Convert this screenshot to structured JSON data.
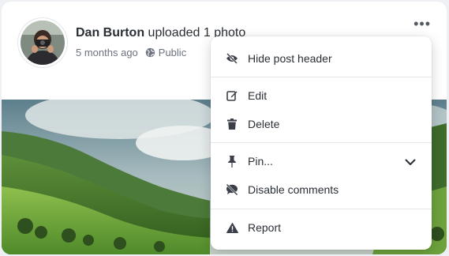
{
  "post": {
    "author": "Dan Burton",
    "action": " uploaded 1 photo",
    "time": "5 months ago",
    "visibility": "Public",
    "more_label": "•••"
  },
  "menu": {
    "items": [
      {
        "label": "Hide post header",
        "icon": "eye-slash-icon"
      },
      {
        "label": "Edit",
        "icon": "edit-icon"
      },
      {
        "label": "Delete",
        "icon": "trash-icon"
      },
      {
        "label": "Pin...",
        "icon": "pin-icon"
      },
      {
        "label": "Disable comments",
        "icon": "comment-slash-icon"
      },
      {
        "label": "Report",
        "icon": "warning-icon"
      }
    ]
  },
  "colors": {
    "text": "#2a2f36",
    "muted": "#6b7280",
    "separator": "#e5e7eb"
  }
}
